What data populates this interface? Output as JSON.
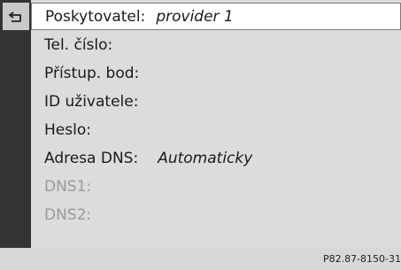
{
  "back_icon": "back-arrow-icon",
  "rows": [
    {
      "label": "Poskytovatel:",
      "value": "provider 1"
    },
    {
      "label": "Tel. číslo:"
    },
    {
      "label": "Přístup. bod:"
    },
    {
      "label": "ID uživatele:"
    },
    {
      "label": "Heslo:"
    },
    {
      "label": "Adresa DNS:",
      "value": "Automaticky"
    },
    {
      "label": "DNS1:"
    },
    {
      "label": "DNS2:"
    }
  ],
  "footer_code": "P82.87-8150-31",
  "colors": {
    "background": "#dcdcdc",
    "left_bar": "#333333",
    "selected_row": "#ffffff",
    "disabled_text": "#9a9a9a"
  }
}
